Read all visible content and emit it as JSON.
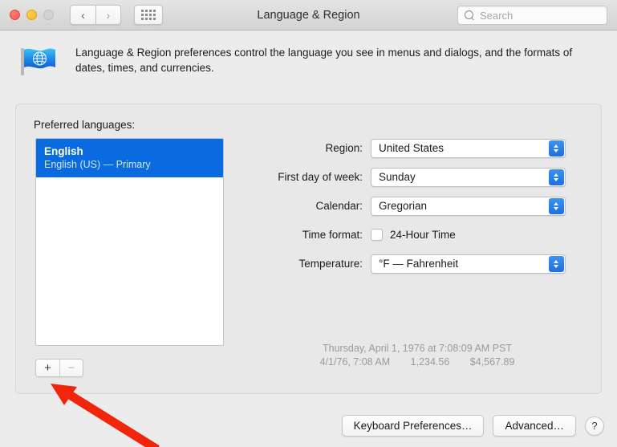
{
  "window": {
    "title": "Language & Region",
    "traffic_lights": [
      {
        "name": "close",
        "color": "#f45a4e"
      },
      {
        "name": "minimize",
        "color": "#f7b529"
      },
      {
        "name": "zoom",
        "color": "#d3d3d3"
      }
    ],
    "nav": {
      "back": "‹",
      "forward": "›"
    },
    "grid_button": "show-all-icon"
  },
  "search": {
    "placeholder": "Search",
    "value": "",
    "icon": "search-icon"
  },
  "header": {
    "icon": "language-region-flag-icon",
    "description": "Language & Region preferences control the language you see in menus and dialogs, and the formats of dates, times, and currencies."
  },
  "languages": {
    "label": "Preferred languages:",
    "items": [
      {
        "name": "English",
        "detail": "English (US) — Primary",
        "selected": true
      }
    ],
    "add_button": "+",
    "remove_button": "−"
  },
  "form": {
    "rows": [
      {
        "label": "Region:",
        "type": "popup",
        "value": "United States"
      },
      {
        "label": "First day of week:",
        "type": "popup",
        "value": "Sunday"
      },
      {
        "label": "Calendar:",
        "type": "popup",
        "value": "Gregorian"
      },
      {
        "label": "Time format:",
        "type": "checkbox",
        "value": "24-Hour Time",
        "checked": false
      },
      {
        "label": "Temperature:",
        "type": "popup",
        "value": "°F — Fahrenheit"
      }
    ]
  },
  "preview": {
    "line1": "Thursday, April 1, 1976 at 7:08:09 AM PST",
    "date_short": "4/1/76, 7:08 AM",
    "number": "1,234.56",
    "currency": "$4,567.89"
  },
  "footer": {
    "keyboard_preferences": "Keyboard Preferences…",
    "advanced": "Advanced…",
    "help": "?"
  },
  "annotation": {
    "type": "arrow",
    "color": "#f0250b",
    "points_at": "add-language-button"
  },
  "colors": {
    "selection_blue": "#0a6be0",
    "stepper_blue": "#1b6fe0",
    "window_bg": "#ececec",
    "panel_bg": "#e8e8e8",
    "annotation_red": "#f0250b"
  }
}
